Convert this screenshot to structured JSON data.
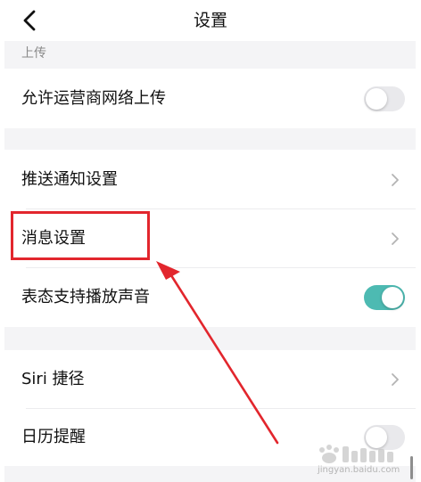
{
  "header": {
    "title": "设置",
    "back_icon": "chevron-left-icon"
  },
  "upload_section": {
    "label": "上传"
  },
  "rows": {
    "carrier_upload": {
      "label": "允许运营商网络上传",
      "toggle_on": false
    },
    "push_notifications": {
      "label": "推送通知设置"
    },
    "message_settings": {
      "label": "消息设置"
    },
    "status_sound": {
      "label": "表态支持播放声音",
      "toggle_on": true
    },
    "siri_shortcuts": {
      "label": "Siri 捷径"
    },
    "calendar_reminder": {
      "label": "日历提醒",
      "toggle_on": false
    }
  },
  "colors": {
    "toggle_on": "#4dbab2",
    "toggle_off": "#e9e9ec",
    "annotation": "#e2262d",
    "gap_background": "#f4f4f6"
  },
  "watermark": {
    "url": "jingyan.baidu.com"
  }
}
